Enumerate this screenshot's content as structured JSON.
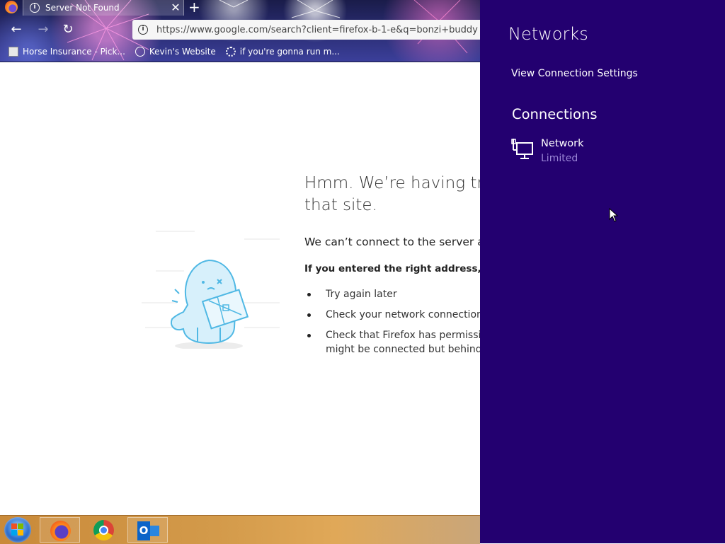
{
  "browser": {
    "tab": {
      "title": "Server Not Found",
      "close_glyph": "✕"
    },
    "new_tab_glyph": "+",
    "nav": {
      "back_glyph": "←",
      "forward_glyph": "→",
      "reload_glyph": "↻"
    },
    "url": "https://www.google.com/search?client=firefox-b-1-e&q=bonzi+buddy",
    "bookmarks": [
      {
        "label": "Horse Insurance - Pick...",
        "icon": "page-icon"
      },
      {
        "label": "Kevin's Website",
        "icon": "globe-icon"
      },
      {
        "label": "if you're gonna run m...",
        "icon": "gear-icon"
      }
    ]
  },
  "error_page": {
    "title_line1": "Hmm. We’re having tro",
    "title_line2": "that site.",
    "description": "We can’t connect to the server at",
    "hint": "If you entered the right address, you",
    "tips": [
      "Try again later",
      "Check your network connection",
      "Check that Firefox has permission",
      "might be connected but behind a"
    ]
  },
  "taskbar": {
    "items": [
      {
        "name": "Firefox",
        "active": true
      },
      {
        "name": "Google Chrome",
        "active": false
      },
      {
        "name": "Outlook",
        "active": true
      }
    ],
    "outlook_letter": "O"
  },
  "networks_panel": {
    "title": "Networks",
    "view_settings_label": "View Connection Settings",
    "connections_heading": "Connections",
    "connection": {
      "name": "Network",
      "status": "Limited",
      "icon": "wired-network-icon"
    },
    "background_color": "#230070",
    "status_color": "#9b86d6"
  }
}
